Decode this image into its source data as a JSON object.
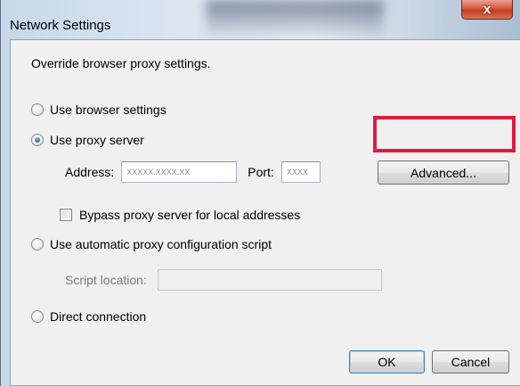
{
  "window": {
    "title": "Network Settings",
    "close_label": "x"
  },
  "description": "Override browser proxy settings.",
  "options": {
    "browser": "Use browser settings",
    "proxy": "Use proxy server",
    "auto": "Use automatic proxy configuration script",
    "direct": "Direct connection"
  },
  "proxy": {
    "address_label": "Address:",
    "address_value": "XXXXX.XXXX.XX",
    "port_label": "Port:",
    "port_value": "XXXX",
    "advanced_label": "Advanced...",
    "bypass_label": "Bypass proxy server for local addresses",
    "bypass_checked": false
  },
  "script": {
    "location_label": "Script location:",
    "location_value": ""
  },
  "selected_option": "proxy",
  "footer": {
    "ok_label": "OK",
    "cancel_label": "Cancel"
  },
  "colors": {
    "highlight": "#e0193e",
    "close_button": "#c43b1e"
  }
}
